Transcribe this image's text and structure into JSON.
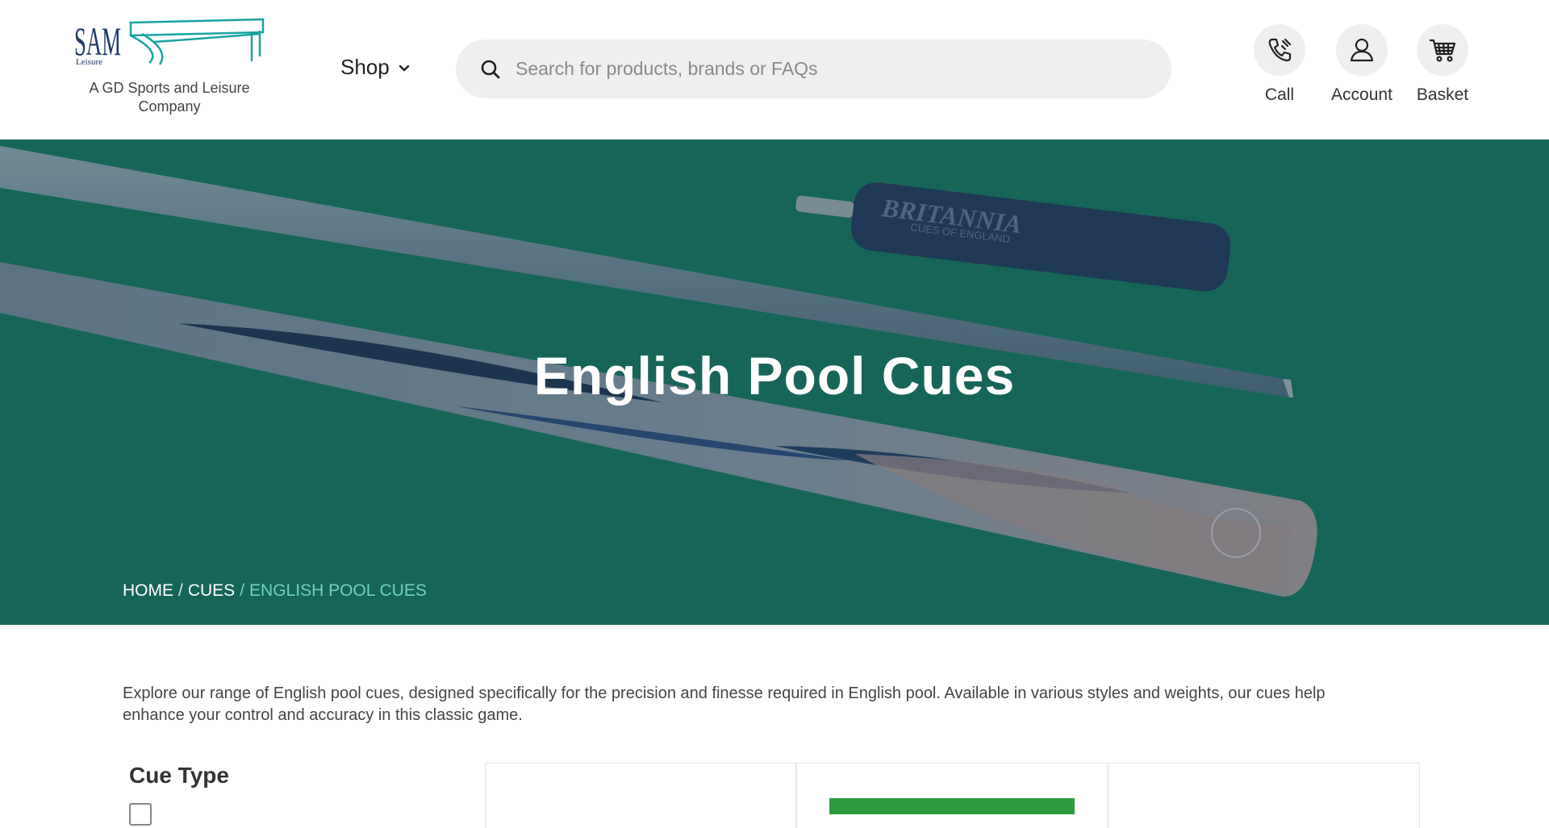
{
  "header": {
    "logo": {
      "brand": "SAM",
      "brand_small": "Leisure",
      "tagline": "A GD Sports and Leisure Company"
    },
    "shop_label": "Shop",
    "search": {
      "placeholder": "Search for products, brands or FAQs"
    },
    "actions": [
      {
        "label": "Call",
        "icon": "phone-icon"
      },
      {
        "label": "Account",
        "icon": "user-icon"
      },
      {
        "label": "Basket",
        "icon": "cart-icon"
      }
    ]
  },
  "hero": {
    "title": "English Pool Cues",
    "extension_brand": "BRITANNIA",
    "extension_sub": "CUES OF ENGLAND",
    "breadcrumb": [
      "HOME",
      "CUES",
      "ENGLISH POOL CUES"
    ],
    "breadcrumb_separator": "/"
  },
  "intro": "Explore our range of English pool cues, designed specifically for the precision and finesse required in English pool. Available in various styles and weights, our cues help enhance your control and accuracy in this classic game.",
  "filters": {
    "title": "Cue Type"
  },
  "colors": {
    "hero_bg": "#1a6f62",
    "breadcrumb_current": "#6fd1c0",
    "card_accent": "#2e9a3f"
  }
}
